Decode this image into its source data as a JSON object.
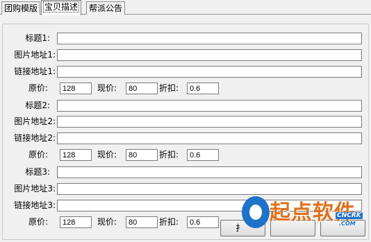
{
  "tabs": [
    "团购模版",
    "宝贝描述",
    "帮派公告"
  ],
  "groups": [
    {
      "title_label": "标题1:",
      "image_label": "图片地址1:",
      "link_label": "链接地址1:",
      "title_value": "",
      "image_value": "",
      "link_value": "",
      "orig_label": "原价:",
      "orig_value": "128",
      "now_label": "现价:",
      "now_value": "80",
      "disc_label": "折扣:",
      "disc_value": "0.6"
    },
    {
      "title_label": "标题2:",
      "image_label": "图片地址2:",
      "link_label": "链接地址2:",
      "title_value": "",
      "image_value": "",
      "link_value": "",
      "orig_label": "原价:",
      "orig_value": "128",
      "now_label": "现价:",
      "now_value": "80",
      "disc_label": "折扣:",
      "disc_value": "0.6"
    },
    {
      "title_label": "标题3:",
      "image_label": "图片地址3:",
      "link_label": "链接地址3:",
      "title_value": "",
      "image_value": "",
      "link_value": "",
      "orig_label": "原价:",
      "orig_value": "128",
      "now_label": "现价:",
      "now_value": "80",
      "disc_label": "折扣:",
      "disc_value": "0.6"
    }
  ],
  "buttons": [
    "扌",
    "",
    ""
  ],
  "watermark": {
    "brand": "起点软件",
    "badge": "CNCRK",
    "domain": ".COM"
  }
}
